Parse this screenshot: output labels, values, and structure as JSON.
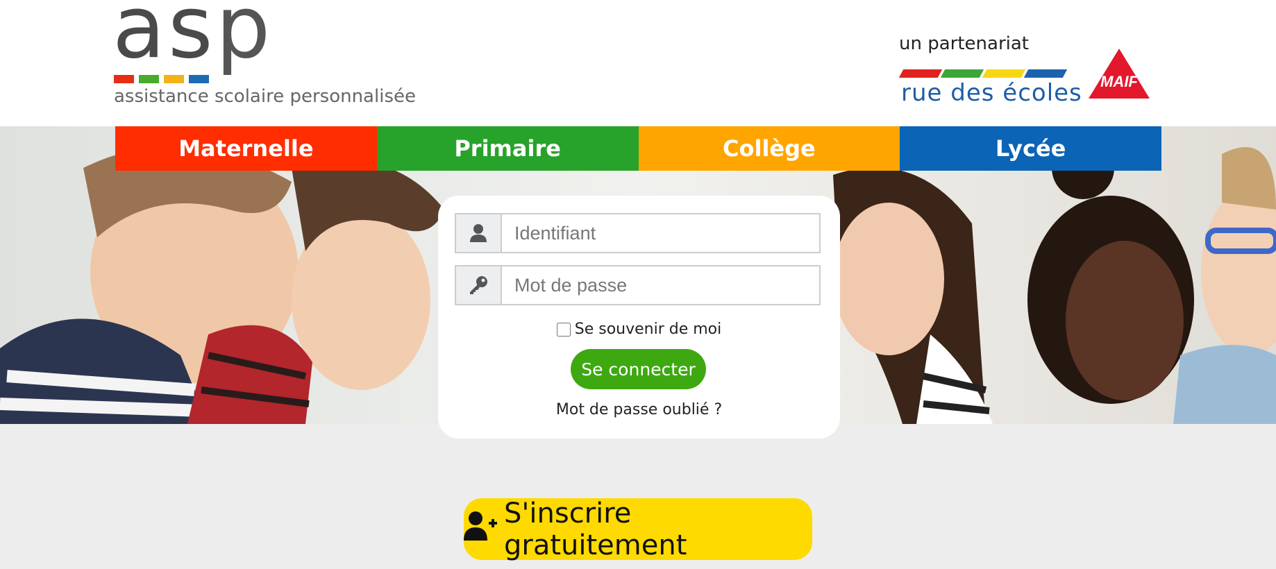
{
  "logo": {
    "word_a": "a",
    "word_s": "s",
    "word_p": "p",
    "tagline": "assistance scolaire personnalisée",
    "bar_colors": [
      "#e62e12",
      "#4aaa2c",
      "#f1b21a",
      "#1c6bb5"
    ]
  },
  "partner": {
    "label": "un partenariat",
    "rue_des_ecoles": "rue des écoles",
    "rde_bar_colors": [
      "#e0221f",
      "#3da63a",
      "#f6d716",
      "#1b63ae"
    ],
    "maif": "MAIF",
    "maif_color": "#e3182d"
  },
  "nav": {
    "items": [
      {
        "label": "Maternelle",
        "color": "#ff2d00"
      },
      {
        "label": "Primaire",
        "color": "#27a22b"
      },
      {
        "label": "Collège",
        "color": "#ffa500"
      },
      {
        "label": "Lycée",
        "color": "#0b64b6"
      }
    ]
  },
  "login": {
    "username_placeholder": "Identifiant",
    "password_placeholder": "Mot de passe",
    "remember_label": "Se souvenir de moi",
    "submit_label": "Se connecter",
    "forgot_label": "Mot de passe oublié ?"
  },
  "signup": {
    "label": "S'inscrire gratuitement",
    "icon": "user-plus-icon"
  },
  "colors": {
    "connect_button": "#3ea811",
    "signup_button": "#ffda00",
    "page_background": "#ededed"
  }
}
